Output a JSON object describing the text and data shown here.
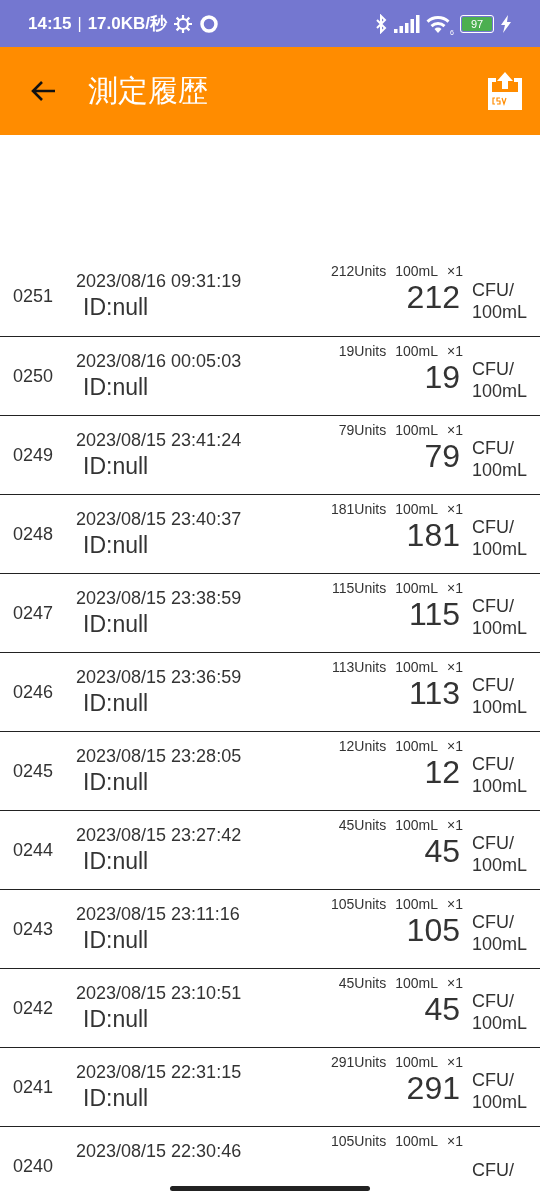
{
  "status_bar": {
    "time": "14:15",
    "separator": "|",
    "speed": "17.0KB/秒",
    "wifi_badge": "6",
    "battery": "97"
  },
  "app_bar": {
    "title": "測定履歴"
  },
  "records": [
    {
      "number": "0251",
      "datetime": "2023/08/16 09:31:19",
      "id": "ID:null",
      "units": "212Units",
      "volume": "100mL",
      "multiplier": "×1",
      "value": "212",
      "unit_top": "CFU/",
      "unit_bottom": "100mL"
    },
    {
      "number": "0250",
      "datetime": "2023/08/16 00:05:03",
      "id": "ID:null",
      "units": "19Units",
      "volume": "100mL",
      "multiplier": "×1",
      "value": "19",
      "unit_top": "CFU/",
      "unit_bottom": "100mL"
    },
    {
      "number": "0249",
      "datetime": "2023/08/15 23:41:24",
      "id": "ID:null",
      "units": "79Units",
      "volume": "100mL",
      "multiplier": "×1",
      "value": "79",
      "unit_top": "CFU/",
      "unit_bottom": "100mL"
    },
    {
      "number": "0248",
      "datetime": "2023/08/15 23:40:37",
      "id": "ID:null",
      "units": "181Units",
      "volume": "100mL",
      "multiplier": "×1",
      "value": "181",
      "unit_top": "CFU/",
      "unit_bottom": "100mL"
    },
    {
      "number": "0247",
      "datetime": "2023/08/15 23:38:59",
      "id": "ID:null",
      "units": "115Units",
      "volume": "100mL",
      "multiplier": "×1",
      "value": "115",
      "unit_top": "CFU/",
      "unit_bottom": "100mL"
    },
    {
      "number": "0246",
      "datetime": "2023/08/15 23:36:59",
      "id": "ID:null",
      "units": "113Units",
      "volume": "100mL",
      "multiplier": "×1",
      "value": "113",
      "unit_top": "CFU/",
      "unit_bottom": "100mL"
    },
    {
      "number": "0245",
      "datetime": "2023/08/15 23:28:05",
      "id": "ID:null",
      "units": "12Units",
      "volume": "100mL",
      "multiplier": "×1",
      "value": "12",
      "unit_top": "CFU/",
      "unit_bottom": "100mL"
    },
    {
      "number": "0244",
      "datetime": "2023/08/15 23:27:42",
      "id": "ID:null",
      "units": "45Units",
      "volume": "100mL",
      "multiplier": "×1",
      "value": "45",
      "unit_top": "CFU/",
      "unit_bottom": "100mL"
    },
    {
      "number": "0243",
      "datetime": "2023/08/15 23:11:16",
      "id": "ID:null",
      "units": "105Units",
      "volume": "100mL",
      "multiplier": "×1",
      "value": "105",
      "unit_top": "CFU/",
      "unit_bottom": "100mL"
    },
    {
      "number": "0242",
      "datetime": "2023/08/15 23:10:51",
      "id": "ID:null",
      "units": "45Units",
      "volume": "100mL",
      "multiplier": "×1",
      "value": "45",
      "unit_top": "CFU/",
      "unit_bottom": "100mL"
    },
    {
      "number": "0241",
      "datetime": "2023/08/15 22:31:15",
      "id": "ID:null",
      "units": "291Units",
      "volume": "100mL",
      "multiplier": "×1",
      "value": "291",
      "unit_top": "CFU/",
      "unit_bottom": "100mL"
    },
    {
      "number": "0240",
      "datetime": "2023/08/15 22:30:46",
      "units": "105Units",
      "volume": "100mL",
      "multiplier": "×1",
      "unit_top": "CFU/"
    }
  ]
}
